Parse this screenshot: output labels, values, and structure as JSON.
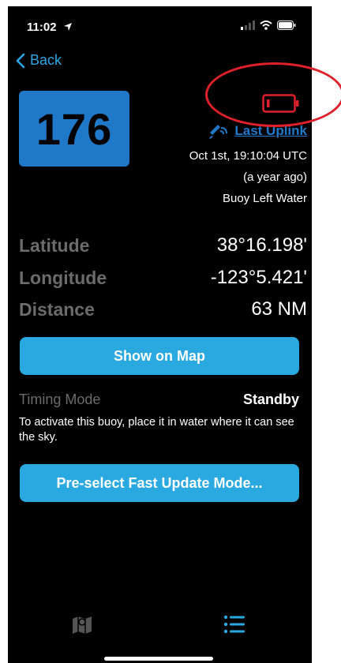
{
  "status_bar": {
    "time": "11:02"
  },
  "nav": {
    "back_label": "Back"
  },
  "buoy": {
    "number": "176"
  },
  "uplink": {
    "label": "Last Uplink",
    "datetime": "Oct 1st, 19:10:04 UTC",
    "relative": "(a year ago)",
    "status": "Buoy Left Water"
  },
  "stats": [
    {
      "label": "Latitude",
      "value": "38°16.198'"
    },
    {
      "label": "Longitude",
      "value": "-123°5.421'"
    },
    {
      "label": "Distance",
      "value": "63 NM"
    }
  ],
  "buttons": {
    "show_on_map": "Show on Map",
    "preselect_fast_update": "Pre-select Fast Update Mode..."
  },
  "timing": {
    "label": "Timing Mode",
    "value": "Standby",
    "note": "To activate this buoy, place it in water where it can see the sky."
  },
  "tabs": [
    {
      "name": "map-tab",
      "icon": "map-icon"
    },
    {
      "name": "list-tab",
      "icon": "list-icon"
    }
  ],
  "colors": {
    "accent": "#2aa9e0",
    "buoy_box": "#1f78c8",
    "battery_low": "#e0202a",
    "label_gray": "#6b6b6b"
  }
}
